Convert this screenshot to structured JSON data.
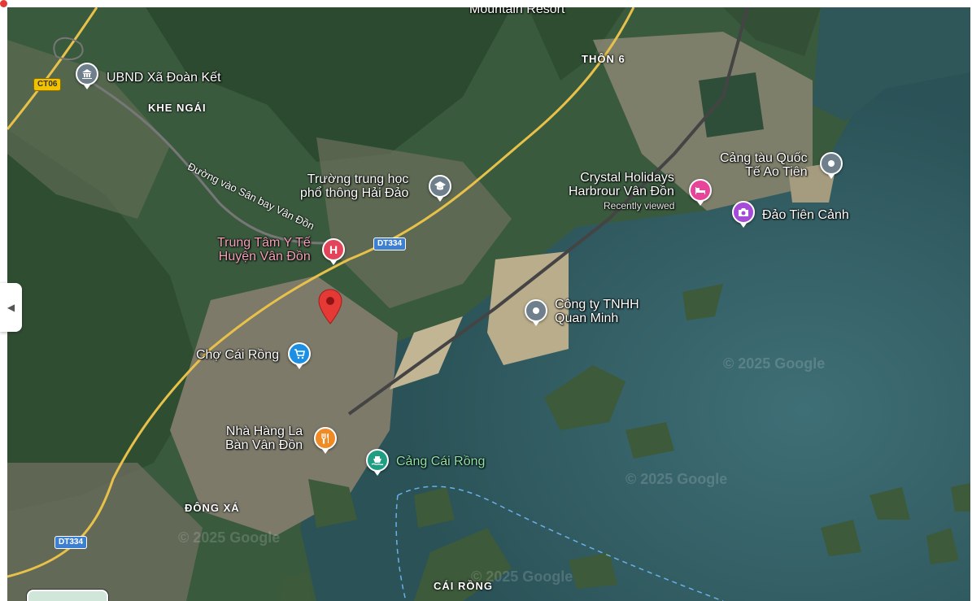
{
  "labels": {
    "ubnd": "UBND Xã Đoàn Kết",
    "thon6": "THÔN 6",
    "khe_ngai": "KHE NGÁI",
    "road_airport": "Đường vào Sân bay Vân Đồn",
    "truong_l1": "Trường trung học",
    "truong_l2": "phổ thông Hải Đảo",
    "crystal_l1": "Crystal Holidays",
    "crystal_l2": "Harbrour Vân Đồn",
    "recently_viewed": "Recently viewed",
    "cang_qt_l1": "Cảng tàu Quốc",
    "cang_qt_l2": "Tế Ao Tiên",
    "dao_tien_canh": "Đảo Tiên Cảnh",
    "trung_tam_l1": "Trung Tâm Y Tế",
    "trung_tam_l2": "Huyện Vân Đồn",
    "cong_ty_l1": "Công ty TNHH",
    "cong_ty_l2": "Quan Minh",
    "cho": "Chợ Cái Rồng",
    "nha_hang_l1": "Nhà Hàng La",
    "nha_hang_l2": "Bàn Vân Đồn",
    "cang_cai_rong": "Cảng Cái Rồng",
    "dong_xa": "ĐÔNG XÁ",
    "cai_rong": "CÁI RỒNG",
    "top_partial": "Mountain Resort"
  },
  "shields": {
    "ct06": "CT06",
    "dt334_a": "DT334",
    "dt334_b": "DT334"
  },
  "watermarks": {
    "w1": "© 2025 Google",
    "w2": "© 2025 Google",
    "w3": "© 2025 Google",
    "w4": "© 2025 Google"
  },
  "icons": {
    "ubnd": "government-building-icon",
    "truong": "school-icon",
    "crystal": "hotel-icon",
    "cang_qt": "place-icon",
    "dao": "camera-icon",
    "trung_tam": "hospital-icon",
    "cong_ty": "place-icon",
    "cho": "shopping-cart-icon",
    "nha_hang": "restaurant-icon",
    "cang_cai_rong": "ferry-icon",
    "selected": "red-marker-icon"
  },
  "colors": {
    "hospital": "#e2455a",
    "hotel": "#e8449a",
    "camera": "#a64bd8",
    "generic": "#6f7f8c",
    "shopping": "#1a8fe3",
    "restaurant": "#f08a24",
    "ferry": "#1f9e82",
    "marker": "#e53935",
    "road_major": "#e8c14a"
  }
}
